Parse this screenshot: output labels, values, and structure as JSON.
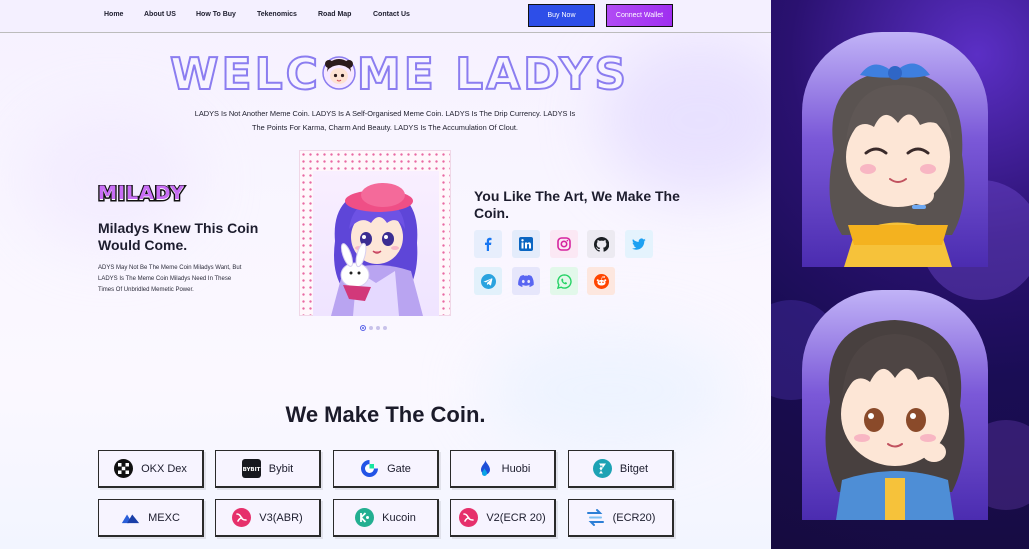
{
  "nav": {
    "links": [
      "Home",
      "About US",
      "How To Buy",
      "Tekenomics",
      "Road Map",
      "Contact Us"
    ],
    "buy_label": "Buy Now",
    "wallet_label": "Connect Wallet"
  },
  "hero": {
    "title_left": "WELC",
    "title_right": "ME LADYS",
    "intro_line1": "LADYS Is Not Another Meme Coin. LADYS Is A Self-Organised Meme Coin. LADYS Is The Drip Currency. LADYS Is",
    "intro_line2": "The Points For Karma, Charm And Beauty. LADYS Is The Accumulation Of Clout."
  },
  "left": {
    "logo_text": "MILADY",
    "heading": "Miladys Knew This Coin Would Come.",
    "desc_lines": [
      "ADYS May Not Be The Meme Coin Miladys Want, But",
      "LADYS Is The Meme Coin Miladys Need In These",
      "Times Of Unbridled Memetic Power."
    ]
  },
  "carousel": {
    "slides": 4,
    "active": 0
  },
  "social": {
    "heading": "You Like The Art, We Make The Coin.",
    "icons": [
      {
        "name": "facebook-icon",
        "color": "#1877f2"
      },
      {
        "name": "linkedin-icon",
        "color": "#0a66c2"
      },
      {
        "name": "instagram-icon",
        "color": "#d6249f"
      },
      {
        "name": "github-icon",
        "color": "#1b1f23"
      },
      {
        "name": "twitter-icon",
        "color": "#1da1f2"
      },
      {
        "name": "telegram-icon",
        "color": "#2aa3df"
      },
      {
        "name": "discord-icon",
        "color": "#5865f2"
      },
      {
        "name": "whatsapp-icon",
        "color": "#25d366"
      },
      {
        "name": "reddit-icon",
        "color": "#ff4500"
      }
    ]
  },
  "exchanges": {
    "heading": "We Make The Coin.",
    "items": [
      {
        "label": "OKX Dex",
        "icon": "okx-icon"
      },
      {
        "label": "Bybit",
        "icon": "bybit-icon"
      },
      {
        "label": "Gate",
        "icon": "gate-icon"
      },
      {
        "label": "Huobi",
        "icon": "huobi-icon"
      },
      {
        "label": "Bitget",
        "icon": "bitget-icon"
      },
      {
        "label": "MEXC",
        "icon": "mexc-icon"
      },
      {
        "label": "V3(ABR)",
        "icon": "uniswap-icon"
      },
      {
        "label": "Kucoin",
        "icon": "kucoin-icon"
      },
      {
        "label": "V2(ECR 20)",
        "icon": "uniswap-icon"
      },
      {
        "label": "(ECR20)",
        "icon": "swap-icon"
      }
    ]
  },
  "colors": {
    "accent_blue": "#2d4ee8",
    "accent_purple": "#a43ff2",
    "title_stroke": "#8b7df0",
    "panel_bg": "#1a0d55"
  }
}
